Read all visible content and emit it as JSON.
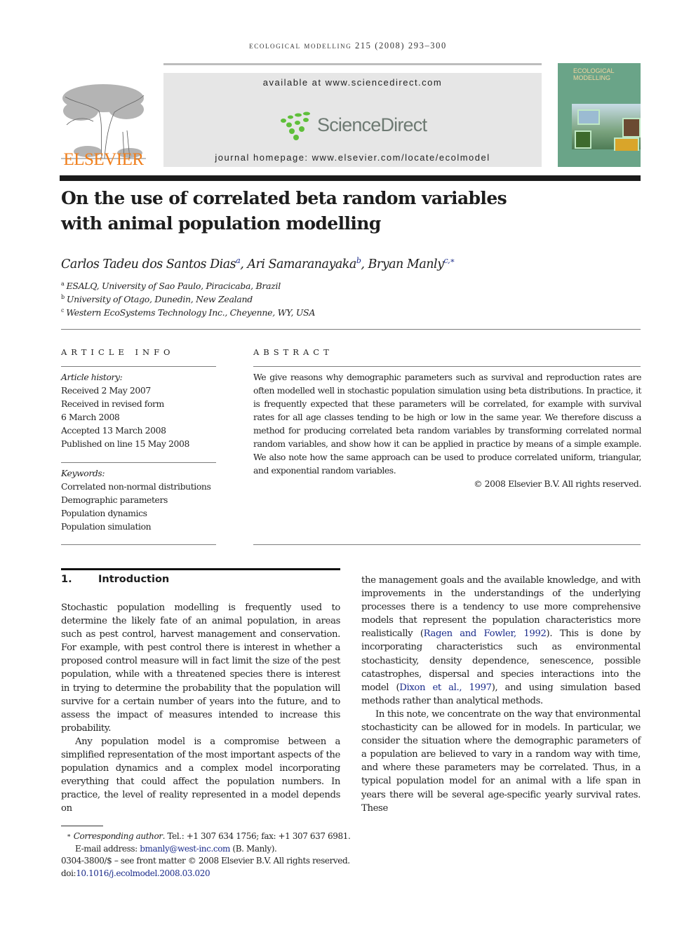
{
  "running_head": "ecological modelling 215 (2008) 293–300",
  "publisher": {
    "name": "ELSEVIER",
    "brand_color": "#f07f1c"
  },
  "banner": {
    "available_at": "available at www.sciencedirect.com",
    "logo_text": "ScienceDirect",
    "logo_color": "#6e7a73",
    "dots_color": "#5fbf3a",
    "journal_homepage": "journal homepage: www.elsevier.com/locate/ecolmodel"
  },
  "cover": {
    "title_line1": "ECOLOGICAL",
    "title_line2": "MODELLING"
  },
  "article": {
    "title_line1": "On the use of correlated beta random variables",
    "title_line2": "with animal population modelling",
    "authors": [
      {
        "name": "Carlos Tadeu dos Santos Dias",
        "affil": "a"
      },
      {
        "name": "Ari Samaranayaka",
        "affil": "b"
      },
      {
        "name": "Bryan Manly",
        "affil": "c,∗"
      }
    ],
    "affiliations": [
      {
        "mark": "a",
        "text": "ESALQ, University of Sao Paulo, Piracicaba, Brazil"
      },
      {
        "mark": "b",
        "text": "University of Otago, Dunedin, New Zealand"
      },
      {
        "mark": "c",
        "text": "Western EcoSystems Technology Inc., Cheyenne, WY, USA"
      }
    ]
  },
  "article_info": {
    "heading": "ARTICLE INFO",
    "history_label": "Article history:",
    "history": [
      "Received 2 May 2007",
      "Received in revised form",
      "6 March 2008",
      "Accepted 13 March 2008",
      "Published on line 15 May 2008"
    ],
    "keywords_label": "Keywords:",
    "keywords": [
      "Correlated non-normal distributions",
      "Demographic parameters",
      "Population dynamics",
      "Population simulation"
    ]
  },
  "abstract": {
    "heading": "ABSTRACT",
    "text": "We give reasons why demographic parameters such as survival and reproduction rates are often modelled well in stochastic population simulation using beta distributions. In practice, it is frequently expected that these parameters will be correlated, for example with survival rates for all age classes tending to be high or low in the same year. We therefore discuss a method for producing correlated beta random variables by transforming correlated normal random variables, and show how it can be applied in practice by means of a simple example. We also note how the same approach can be used to produce correlated uniform, triangular, and exponential random variables.",
    "copyright": "© 2008 Elsevier B.V. All rights reserved."
  },
  "introduction": {
    "number": "1.",
    "title": "Introduction",
    "p1": "Stochastic population modelling is frequently used to determine the likely fate of an animal population, in areas such as pest control, harvest management and conservation. For example, with pest control there is interest in whether a proposed control measure will in fact limit the size of the pest population, while with a threatened species there is interest in trying to determine the probability that the population will survive for a certain number of years into the future, and to assess the impact of measures intended to increase this probability.",
    "p2": "Any population model is a compromise between a simplified representation of the most important aspects of the population dynamics and a complex model incorporating everything that could affect the population numbers. In practice, the level of reality represented in a model depends on",
    "p2_cont_a": "the management goals and the available knowledge, and with improvements in the understandings of the underlying processes there is a tendency to use more comprehensive models that represent the population characteristics more realistically (",
    "cite1": "Ragen and Fowler, 1992",
    "p2_cont_b": "). This is done by incorporating characteristics such as environmental stochasticity, density dependence, senescence, possible catastrophes, dispersal and species interactions into the model (",
    "cite2": "Dixon et al., 1997",
    "p2_cont_c": "), and using simulation based methods rather than analytical methods.",
    "p3": "In this note, we concentrate on the way that environmental stochasticity can be allowed for in models. In particular, we consider the situation where the demographic parameters of a population are believed to vary in a random way with time, and where these parameters may be correlated. Thus, in a typical population model for an animal with a life span in years there will be several age-specific yearly survival rates. These"
  },
  "footnotes": {
    "star": "∗",
    "corresponding_label": "Corresponding author",
    "contact": ". Tel.: +1 307 634 1756; fax: +1 307 637 6981.",
    "email_label": "E-mail address: ",
    "email": "bmanly@west-inc.com",
    "email_suffix": " (B. Manly).",
    "front_matter": "0304-3800/$ – see front matter © 2008 Elsevier B.V. All rights reserved.",
    "doi_label": "doi:",
    "doi": "10.1016/j.ecolmodel.2008.03.020"
  }
}
